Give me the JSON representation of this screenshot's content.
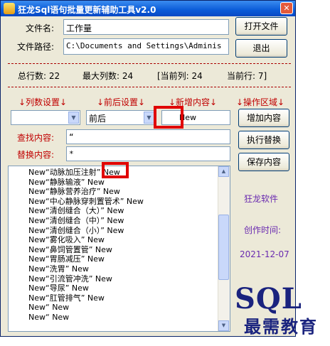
{
  "window": {
    "title": "狂龙Sql语句批量更新辅助工具v2.0",
    "close_glyph": "✕"
  },
  "file": {
    "name_label": "文件名:",
    "name_value": "工作量",
    "path_label": "文件路径:",
    "path_value": "C:\\Documents and Settings\\Adminis"
  },
  "buttons": {
    "open": "打开文件",
    "exit": "退出",
    "add": "增加内容",
    "replace": "执行替换",
    "save": "保存内容"
  },
  "status": {
    "total_rows": "总行数: 22",
    "max_cols": "最大列数: 24",
    "current_col": "[当前列: 24",
    "current_row": "当前行: 7]"
  },
  "sections": {
    "col_settings": "↓列数设置↓",
    "prepost_settings": "↓前后设置↓",
    "new_content": "↓新增内容↓",
    "operation": "↓操作区域↓"
  },
  "inputs": {
    "col_select": "",
    "prepost_select": "前后",
    "new_content": "New",
    "find_label": "查找内容:",
    "find_value": "“",
    "replace_label": "替换内容:",
    "replace_value": "*"
  },
  "list_rows": [
    "New“动脉加压注射”     New",
    "New“静脉输液”     New",
    "New“静脉营养治疗”     New",
    "New“中心静脉穿刺置管术”     New",
    "New“清创缝合（大）”     New",
    "New“清创缝合（中）”     New",
    "New“清创缝合（小）”     New",
    "New“雾化吸入”     New",
    "New“鼻饲管置管”     New",
    "New“胃肠减压”     New",
    "New“洗胃”     New",
    "New“引流管冲洗”     New",
    "New“导尿”     New",
    "New“肛管排气”     New",
    "New“     New",
    "New“     New"
  ],
  "side": {
    "brand": "狂龙软件",
    "created_label": "创作时间:",
    "created_date": "2021-12-07"
  },
  "watermark": {
    "sql": "SQL",
    "text": "最需教育"
  },
  "colors": {
    "title_bar": "#0a5bd8",
    "section_red": "#c00000",
    "side_purple": "#6a2ab0",
    "highlight_box": "#e00000"
  },
  "icons": {
    "dropdown": "▼",
    "scroll_up": "▲",
    "scroll_down": "▼"
  }
}
